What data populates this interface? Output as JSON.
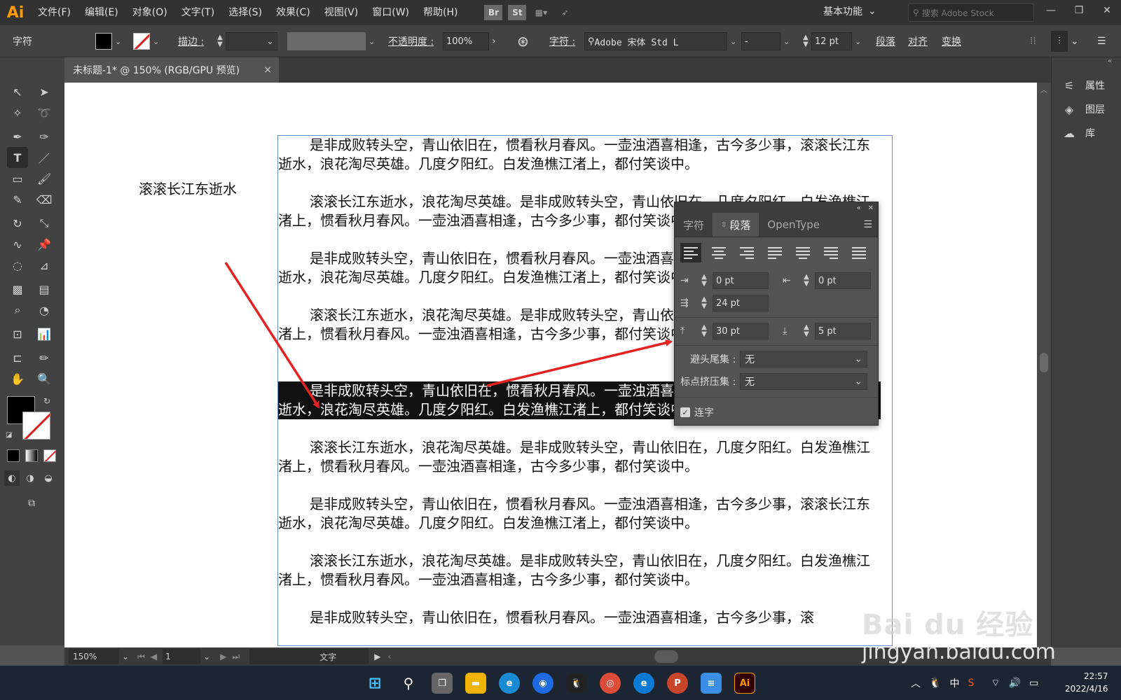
{
  "app": {
    "logo": "Ai"
  },
  "menu": [
    "文件(F)",
    "编辑(E)",
    "对象(O)",
    "文字(T)",
    "选择(S)",
    "效果(C)",
    "视图(V)",
    "窗口(W)",
    "帮助(H)"
  ],
  "menubar_icons": {
    "br": "Br",
    "st": "St"
  },
  "workspace": {
    "label": "基本功能"
  },
  "stock_search": {
    "placeholder": "搜索 Adobe Stock"
  },
  "control_bar": {
    "panel_label": "字符",
    "stroke_label": "描边 :",
    "opacity_label": "不透明度 :",
    "opacity_value": "100%",
    "char_label": "字符 :",
    "font_name": "Adobe 宋体 Std L",
    "font_style": "-",
    "font_size": "12 pt",
    "paragraph_link": "段落",
    "align_link": "对齐",
    "transform_link": "变换"
  },
  "document_tab": {
    "title": "未标题-1* @ 150% (RGB/GPU 预览)",
    "close": "×"
  },
  "canvas": {
    "loose_text": "滚滚长江东逝水",
    "paragraphs": [
      {
        "text": "是非成败转头空，青山依旧在，惯看秋月春风。一壶浊酒喜相逢，古今多少事，滚滚长江东逝水，浪花淘尽英雄。几度夕阳红。白发渔樵江渚上，都付笑谈中。",
        "selected": false
      },
      {
        "text": "滚滚长江东逝水，浪花淘尽英雄。是非成败转头空，青山依旧在，几度夕阳红。白发渔樵江渚上，惯看秋月春风。一壶浊酒喜相逢，古今多少事，都付笑谈中。",
        "selected": false
      },
      {
        "text": "是非成败转头空，青山依旧在，惯看秋月春风。一壶浊酒喜相逢，古今多少事，滚滚长江东逝水，浪花淘尽英雄。几度夕阳红。白发渔樵江渚上，都付笑谈中。",
        "selected": false
      },
      {
        "text": "滚滚长江东逝水，浪花淘尽英雄。是非成败转头空，青山依旧在，几度夕阳红。白发渔樵江渚上，惯看秋月春风。一壶浊酒喜相逢，古今多少事，都付笑谈中。",
        "selected": false
      },
      {
        "text": "是非成败转头空，青山依旧在，惯看秋月春风。一壶浊酒喜相逢，古今多少事，滚滚长江东逝水，浪花淘尽英雄。几度夕阳红。白发渔樵江渚上，都付笑谈中。",
        "selected": true
      },
      {
        "text": "滚滚长江东逝水，浪花淘尽英雄。是非成败转头空，青山依旧在，几度夕阳红。白发渔樵江渚上，惯看秋月春风。一壶浊酒喜相逢，古今多少事，都付笑谈中。",
        "selected": false
      },
      {
        "text": "是非成败转头空，青山依旧在，惯看秋月春风。一壶浊酒喜相逢，古今多少事，滚滚长江东逝水，浪花淘尽英雄。几度夕阳红。白发渔樵江渚上，都付笑谈中。",
        "selected": false
      },
      {
        "text": "滚滚长江东逝水，浪花淘尽英雄。是非成败转头空，青山依旧在，几度夕阳红。白发渔樵江渚上，惯看秋月春风。一壶浊酒喜相逢，古今多少事，都付笑谈中。",
        "selected": false
      },
      {
        "text": "是非成败转头空，青山依旧在，惯看秋月春风。一壶浊酒喜相逢，古今多少事，滚",
        "selected": false
      }
    ]
  },
  "paragraph_panel": {
    "tabs": [
      "字符",
      "段落",
      "OpenType"
    ],
    "active_tab": "段落",
    "left_indent": "0 pt",
    "right_indent": "0 pt",
    "first_line_indent": "24 pt",
    "space_before": "30 pt",
    "space_after": "5 pt",
    "kinsoku_label": "避头尾集 :",
    "kinsoku_value": "无",
    "mojikumi_label": "标点挤压集 :",
    "mojikumi_value": "无",
    "hyphenate_label": "连字",
    "hyphenate_checked": true
  },
  "dock": {
    "properties": "属性",
    "layers": "图层",
    "libraries": "库"
  },
  "status_bar": {
    "zoom": "150%",
    "artboard": "1",
    "tool": "文字"
  },
  "taskbar": {
    "ime": "中",
    "time": "22:57",
    "date": "2022/4/16"
  },
  "watermark": {
    "logo": "Bai du 经验",
    "url": "jingyan.baidu.com"
  },
  "colors": {
    "arrow": "#e52222",
    "accent": "#ff9a00",
    "selection": "#111111"
  }
}
